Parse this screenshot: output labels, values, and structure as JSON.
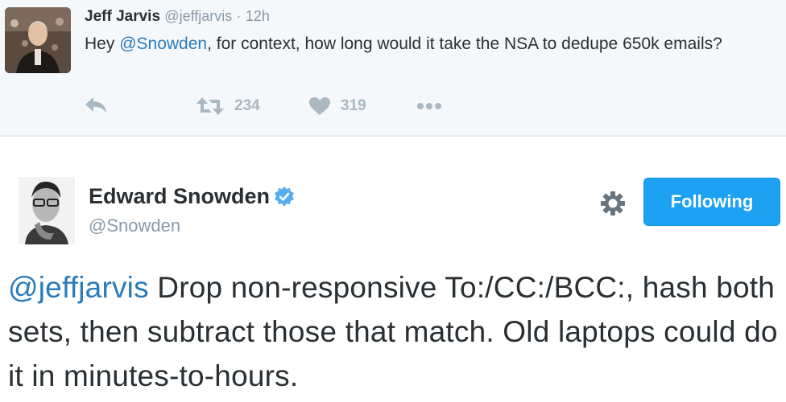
{
  "parent_tweet": {
    "author_name": "Jeff Jarvis",
    "author_handle": "@jeffjarvis",
    "separator": "·",
    "time": "12h",
    "text_prefix": "Hey ",
    "mention": "@Snowden",
    "text_rest": ", for context, how long would it take the NSA to dedupe 650k emails?",
    "retweet_count": "234",
    "like_count": "319",
    "icons": {
      "reply": "reply-icon",
      "retweet": "retweet-icon",
      "like": "heart-icon",
      "more": "more-icon"
    }
  },
  "main_tweet": {
    "author_name": "Edward Snowden",
    "author_handle": "@Snowden",
    "verified": true,
    "follow_button_label": "Following",
    "mention": "@jeffjarvis",
    "text_rest": " Drop non-responsive To:/CC:/BCC:, hash both sets, then subtract those that match. Old laptops could do it in minutes-to-hours.",
    "icons": {
      "verified": "verified-badge-icon",
      "settings": "gear-icon"
    }
  },
  "colors": {
    "accent": "#1da1f2",
    "link": "#2b7bb9",
    "muted": "#8899a6",
    "action_gray": "#aab8c2",
    "parent_bg": "#f5f8fa"
  }
}
